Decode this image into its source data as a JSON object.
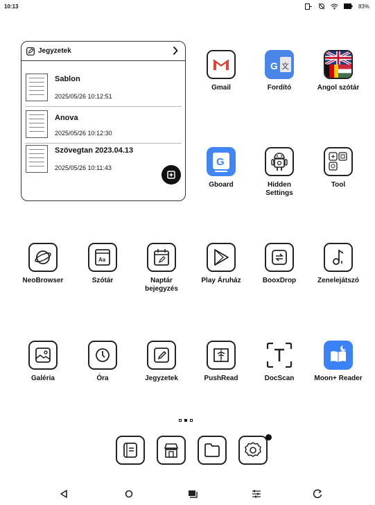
{
  "status_bar": {
    "time": "10:13",
    "battery": "83%",
    "icons": [
      "cast-icon",
      "no-sync-icon",
      "wifi-icon",
      "battery-icon"
    ]
  },
  "notes_widget": {
    "title": "Jegyzetek",
    "notes": [
      {
        "title": "Sablon",
        "date": "2025/05/26 10:12:51"
      },
      {
        "title": "Anova",
        "date": "2025/05/26 10:12:30"
      },
      {
        "title": "Szövegtan 2023.04.13",
        "date": "2025/05/26 10:11:43"
      }
    ]
  },
  "apps": {
    "gmail": "Gmail",
    "translate": "Fordító",
    "dictionary_en": "Angol szótár",
    "gboard": "Gboard",
    "hidden_settings": "Hidden Settings",
    "tool": "Tool",
    "neobrowser": "NeoBrowser",
    "szotar": "Szótár",
    "naptar": "Naptár bejegyzés",
    "playstore": "Play Áruház",
    "booxdrop": "BooxDrop",
    "music": "Zenelejátszó",
    "gallery": "Galéria",
    "clock": "Óra",
    "notes": "Jegyzetek",
    "pushread": "PushRead",
    "docscan": "DocScan",
    "moon_reader": "Moon+ Reader"
  },
  "pager": {
    "pages": 3,
    "current": 2
  },
  "dock": [
    "library-icon",
    "store-icon",
    "folder-icon",
    "settings-icon"
  ],
  "nav_bar": [
    "back-icon",
    "home-icon",
    "recents-icon",
    "tune-icon",
    "refresh-icon"
  ],
  "colors": {
    "accent_blue": "#4a86e8",
    "gmail_red": "#ea4335",
    "gboard_blue": "#4285f4",
    "moon_blue": "#3b82f6"
  }
}
